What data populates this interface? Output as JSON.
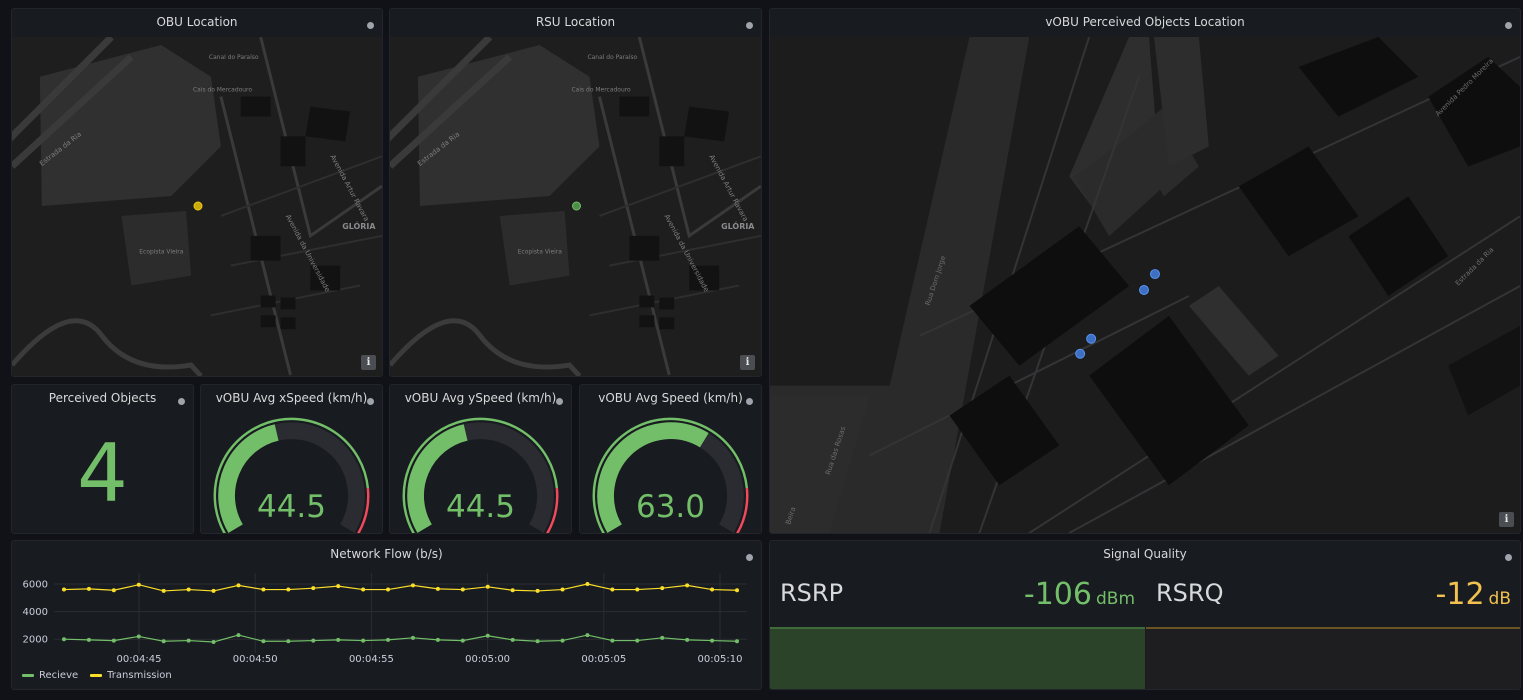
{
  "obu_map": {
    "title": "OBU Location",
    "info": "i",
    "labels": [
      "Estrada da Ria",
      "Canal do Paraíso",
      "Cais do Mercadouro",
      "Avenida da Universidade",
      "GLÓRIA",
      "Ecopista Vieira",
      "Avenida Artur Ravara"
    ],
    "marker_color": "#f2cc0c"
  },
  "rsu_map": {
    "title": "RSU Location",
    "info": "i",
    "labels": [
      "Estrada da Ria",
      "Canal do Paraíso",
      "Cais do Mercadouro",
      "Avenida da Universidade",
      "GLÓRIA",
      "Ecopista Vieira",
      "Avenida Artur Ravara"
    ],
    "marker_color": "#73bf69"
  },
  "vobu_map": {
    "title": "vOBU Perceived Objects Location",
    "info": "i",
    "labels": [
      "Rua Dom Jorge",
      "Rua das Rosas",
      "Avenida Pedro Moreira",
      "Estrada da Ria",
      "Beira"
    ],
    "marker_color": "#5794f2"
  },
  "perceived": {
    "title": "Perceived Objects",
    "value": "4"
  },
  "gauges": [
    {
      "title": "vOBU Avg xSpeed (km/h)",
      "value": "44.5",
      "fraction": 0.445
    },
    {
      "title": "vOBU Avg ySpeed (km/h)",
      "value": "44.5",
      "fraction": 0.445
    },
    {
      "title": "vOBU Avg Speed (km/h)",
      "value": "63.0",
      "fraction": 0.63
    }
  ],
  "network": {
    "title": "Network Flow (b/s)",
    "legend": [
      {
        "name": "Recieve",
        "color": "#73bf69"
      },
      {
        "name": "Transmission",
        "color": "#fade2a"
      }
    ]
  },
  "signal": {
    "title": "Signal Quality",
    "rsrp": {
      "label": "RSRP",
      "value": "-106",
      "unit": "dBm",
      "color": "#73bf69"
    },
    "rsrq": {
      "label": "RSRQ",
      "value": "-12",
      "unit": "dB",
      "color": "#f2c14f"
    }
  },
  "chart_data": {
    "type": "line",
    "title": "Network Flow (b/s)",
    "x_ticks": [
      "00:04:45",
      "00:04:50",
      "00:04:55",
      "00:05:00",
      "00:05:05",
      "00:05:10"
    ],
    "y_ticks": [
      "2000",
      "4000",
      "6000"
    ],
    "ylim": [
      1000,
      6800
    ],
    "grid": true,
    "legend_position": "bottom-left",
    "series": [
      {
        "name": "Recieve",
        "color": "#73bf69",
        "values": [
          2000,
          1950,
          1900,
          2200,
          1850,
          1900,
          1800,
          2300,
          1850,
          1850,
          1900,
          1950,
          1900,
          1950,
          2100,
          1950,
          1900,
          2250,
          1950,
          1850,
          1900,
          2300,
          1900,
          1900,
          2100,
          1950,
          1900,
          1850
        ]
      },
      {
        "name": "Transmission",
        "color": "#fade2a",
        "values": [
          5600,
          5650,
          5550,
          5950,
          5500,
          5600,
          5500,
          5900,
          5600,
          5600,
          5700,
          5850,
          5600,
          5600,
          5900,
          5650,
          5600,
          5800,
          5550,
          5500,
          5600,
          6000,
          5600,
          5600,
          5700,
          5900,
          5600,
          5550
        ]
      }
    ]
  }
}
